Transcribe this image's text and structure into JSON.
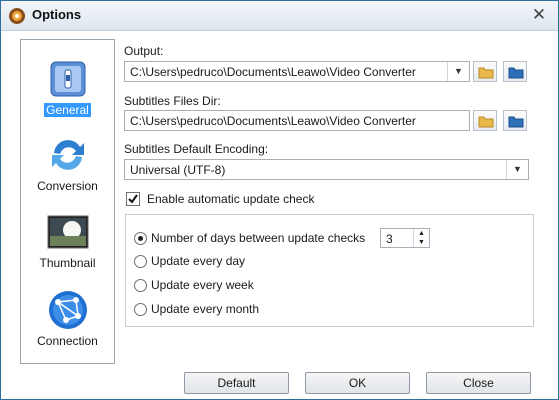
{
  "window": {
    "title": "Options",
    "icon": "leawo-app-icon",
    "close_icon": "close-icon"
  },
  "nav": {
    "items": [
      {
        "label": "General",
        "icon": "general-settings-icon",
        "selected": true
      },
      {
        "label": "Conversion",
        "icon": "conversion-arrows-icon",
        "selected": false
      },
      {
        "label": "Thumbnail",
        "icon": "thumbnail-image-icon",
        "selected": false
      },
      {
        "label": "Connection",
        "icon": "globe-network-icon",
        "selected": false
      }
    ]
  },
  "output": {
    "label": "Output:",
    "value": "C:\\Users\\pedruco\\Documents\\Leawo\\Video Converter"
  },
  "subtitles_dir": {
    "label": "Subtitles Files Dir:",
    "value": "C:\\Users\\pedruco\\Documents\\Leawo\\Video Converter"
  },
  "encoding": {
    "label": "Subtitles Default Encoding:",
    "value": "Universal (UTF-8)"
  },
  "update": {
    "checkbox_label": "Enable automatic update check",
    "checked": true,
    "options": [
      {
        "label": "Number of days between update checks",
        "checked": true
      },
      {
        "label": "Update every day",
        "checked": false
      },
      {
        "label": "Update every week",
        "checked": false
      },
      {
        "label": "Update every month",
        "checked": false
      }
    ],
    "days_value": "3"
  },
  "buttons": {
    "default": "Default",
    "ok": "OK",
    "close": "Close"
  },
  "colors": {
    "selection": "#3399ff",
    "folder_yellow": "#e8b84a",
    "folder_blue": "#2e6fb8"
  }
}
